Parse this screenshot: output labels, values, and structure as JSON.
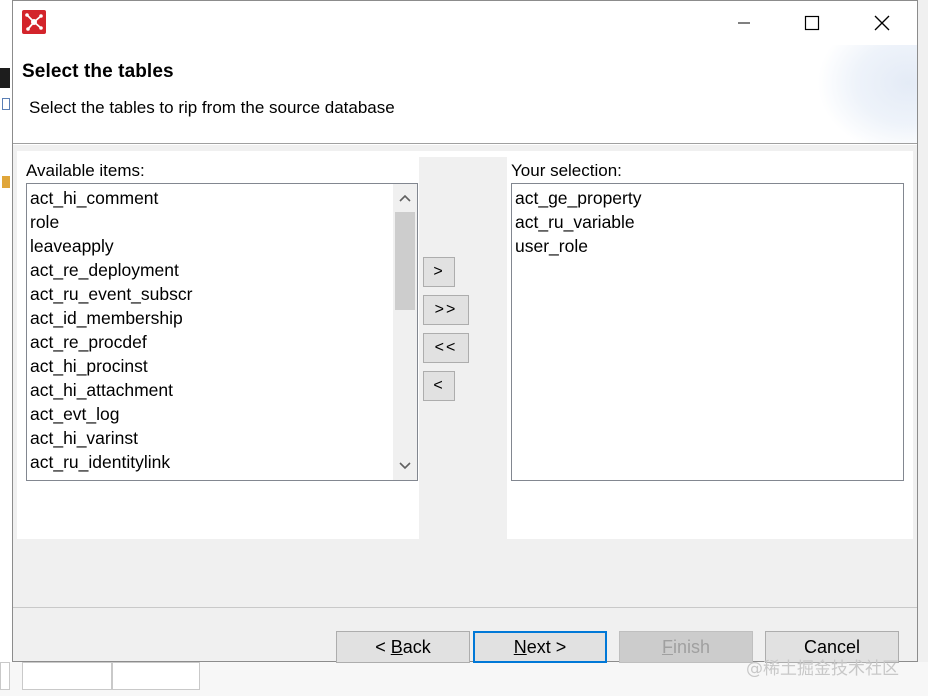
{
  "dialog": {
    "page_title": "Select the tables",
    "page_description": "Select the tables to rip from the source database"
  },
  "available": {
    "label": "Available items:",
    "items": [
      "act_hi_comment",
      "role",
      "leaveapply",
      "act_re_deployment",
      "act_ru_event_subscr",
      "act_id_membership",
      "act_re_procdef",
      "act_hi_procinst",
      "act_hi_attachment",
      "act_evt_log",
      "act_hi_varinst",
      "act_ru_identitylink"
    ]
  },
  "selection": {
    "label": "Your selection:",
    "items": [
      "act_ge_property",
      "act_ru_variable",
      "user_role"
    ]
  },
  "transfer": {
    "add_one": ">",
    "add_all": ">>",
    "remove_all": "<<",
    "remove_one": "<"
  },
  "footer": {
    "back_prefix": "< ",
    "back_mnemonic": "B",
    "back_rest": "ack",
    "next_mnemonic": "N",
    "next_rest": "ext >",
    "finish_mnemonic": "F",
    "finish_rest": "inish",
    "cancel": "Cancel"
  },
  "watermark": "@稀土掘金技术社区",
  "colors": {
    "accent": "#0078d7",
    "app_icon": "#d3242b",
    "list_border": "#828790"
  },
  "icons": {
    "app": "app-logo-icon",
    "minimize": "minimize-icon",
    "maximize": "maximize-icon",
    "close": "close-icon",
    "scroll_up": "chevron-up-icon",
    "scroll_down": "chevron-down-icon"
  }
}
